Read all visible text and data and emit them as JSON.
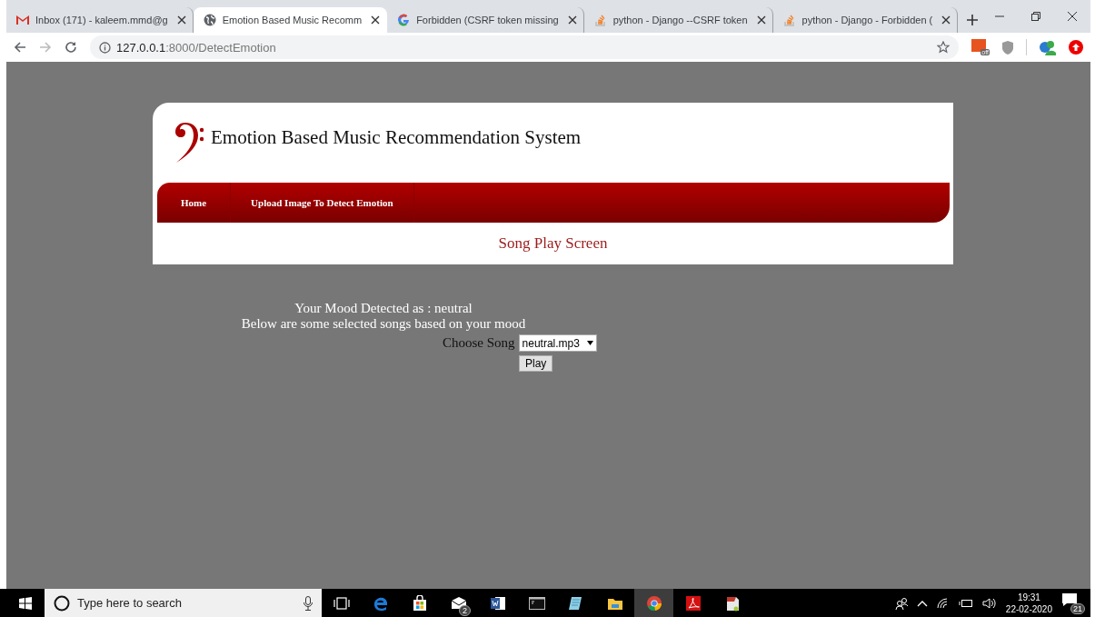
{
  "browser": {
    "tabs": [
      {
        "kind": "gmail",
        "title": "Inbox (171) - kaleem.mmd@g",
        "selected": false
      },
      {
        "kind": "globe",
        "title": "Emotion Based Music Recomm",
        "selected": true
      },
      {
        "kind": "google",
        "title": "Forbidden (CSRF token missing",
        "selected": false
      },
      {
        "kind": "stack",
        "title": "python - Django --CSRF token",
        "selected": false
      },
      {
        "kind": "stack",
        "title": "python - Django - Forbidden (",
        "selected": false
      }
    ],
    "address": {
      "host": "127.0.0.1",
      "path": ":8000/DetectEmotion"
    },
    "extension_badge": "off"
  },
  "page": {
    "title": "Emotion Based Music Recommendation System",
    "nav": [
      {
        "label": "Home"
      },
      {
        "label": "Upload Image To Detect Emotion"
      }
    ],
    "subtitle": "Song Play Screen",
    "mood_line": "Your Mood Detected as : neutral",
    "info_line": "Below are some selected songs based on your mood",
    "choose_label": "Choose Song",
    "song_select": "neutral.mp3",
    "play_button": "Play"
  },
  "taskbar": {
    "search_placeholder": "Type here to search",
    "apps": [
      {
        "kind": "taskview",
        "active": false
      },
      {
        "kind": "edge",
        "active": false
      },
      {
        "kind": "store",
        "active": false
      },
      {
        "kind": "mail",
        "active": false,
        "badge": "2"
      },
      {
        "kind": "word",
        "active": false
      },
      {
        "kind": "cmd",
        "active": false
      },
      {
        "kind": "notepad",
        "active": false
      },
      {
        "kind": "explorer",
        "active": false
      },
      {
        "kind": "chrome",
        "active": true
      },
      {
        "kind": "acrobat",
        "active": false
      },
      {
        "kind": "setup",
        "active": false
      }
    ],
    "time": "19:31",
    "date": "22-02-2020",
    "notifications": "21"
  }
}
